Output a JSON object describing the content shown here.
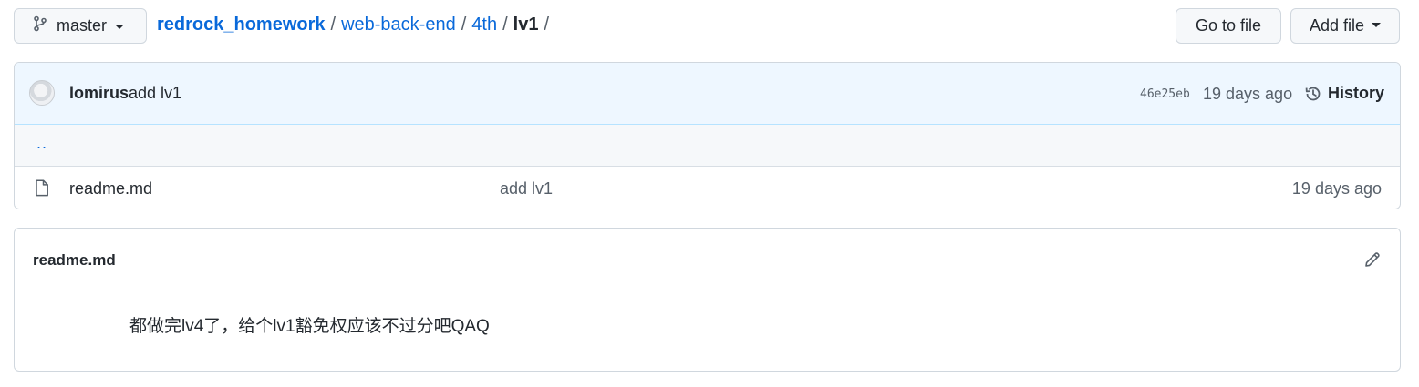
{
  "branch": {
    "label": "master"
  },
  "breadcrumb": {
    "repo": "redrock_homework",
    "crumbs": [
      "web-back-end",
      "4th"
    ],
    "current": "lv1",
    "separator": "/"
  },
  "actions": {
    "goto_file": "Go to file",
    "add_file": "Add file"
  },
  "commit": {
    "author": "lomirus",
    "message": "add lv1",
    "sha": "46e25eb",
    "age": "19 days ago",
    "history_label": "History"
  },
  "files": {
    "parent_link": "..",
    "rows": [
      {
        "name": "readme.md",
        "commit_message": "add lv1",
        "age": "19 days ago",
        "icon": "file-icon"
      }
    ]
  },
  "readme": {
    "title": "readme.md",
    "content": "都做完lv4了，给个lv1豁免权应该不过分吧QAQ"
  },
  "colors": {
    "link": "#0969da",
    "commit_bar": "#eef7ff",
    "border": "#d0d7de",
    "muted": "#57606a"
  }
}
